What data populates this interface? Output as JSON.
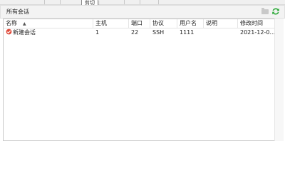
{
  "tooltip": "剪切",
  "panel": {
    "title": "所有会话"
  },
  "icons": {
    "folder": "folder-icon",
    "refresh": "refresh-icon",
    "session": "session-icon",
    "sort": "sort-ascending-icon"
  },
  "colors": {
    "refresh": "#2eaa3a",
    "session_icon": "#e04a3a"
  },
  "table": {
    "columns": [
      "名称",
      "主机",
      "端口",
      "协议",
      "用户名",
      "说明",
      "修改时间"
    ],
    "sort_indicator": "▲",
    "rows": [
      {
        "name": "新建会话",
        "host": "1",
        "port": "22",
        "protocol": "SSH",
        "username": "1111",
        "description": "",
        "modified": "2021-12-0..."
      }
    ]
  }
}
